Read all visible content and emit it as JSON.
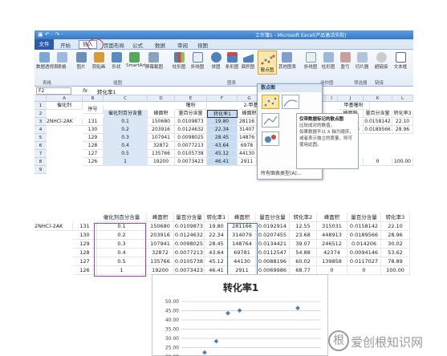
{
  "window": {
    "title": "工作簿1 - Microsoft Excel(产品激活失败)",
    "quick_access": "▣ ↶ · ↷ ·"
  },
  "tabs": [
    "文件",
    "开始",
    "插入",
    "页面布局",
    "公式",
    "数据",
    "审阅",
    "视图"
  ],
  "ribbon": {
    "buttons": [
      "数据透视表",
      "表格",
      "图片",
      "剪贴画",
      "形状",
      "SmartArt",
      "屏幕截图",
      "柱形图",
      "折线图",
      "饼图",
      "条形图",
      "面积图",
      "散点图",
      "其他图表",
      "折线图",
      "柱形图",
      "盈亏",
      "切片器",
      "超链接",
      "文本框"
    ],
    "groups": [
      "表格",
      "插图",
      "图表",
      "迷你图",
      "筛选器",
      "链接"
    ]
  },
  "formula_bar": {
    "name_box": "F2",
    "fx": "fx",
    "value": "转化率1"
  },
  "columns": [
    "A",
    "B",
    "C",
    "D",
    "E",
    "F",
    "G",
    "H",
    "I",
    "J",
    "K",
    "L"
  ],
  "dropdown": {
    "header": "散点图",
    "more": "所有图表类型(A)...",
    "tooltip_title": "仅带数据标记的散点图",
    "tooltip_desc1": "比较成对的数值。",
    "tooltip_desc2": "如果数据不以 X 轴为顺序，或者表示独立的度量，则可使用此图。"
  },
  "top_sheet": {
    "row_numbers": [
      "1",
      "2",
      "3",
      "4",
      "5",
      "6",
      "7",
      "8",
      "9"
    ],
    "catalyst_label": "催化剂",
    "catalyst_value": "2NHCl-2AK",
    "seq_label": "序号",
    "pct_label": "催化剂百分含量",
    "group1_title": "噻吩",
    "group2_title": "2-甲基噻",
    "group3_title": "甲基噻吩",
    "col_area": "峰面积",
    "col_mass": "量百分含量",
    "col_conv1": "转化率1",
    "col_conv3": "转化率3",
    "rows": [
      {
        "seq": "131",
        "pct": "0.1",
        "area": "150680",
        "mass": "0.0109873",
        "conv": "19.80",
        "g": "28116",
        "j": "315031",
        "k": "0.0158142",
        "l": "22.10"
      },
      {
        "seq": "130",
        "pct": "0.2",
        "area": "203916",
        "mass": "0.0124632",
        "conv": "22.34",
        "g": "31407",
        "j": "448913",
        "k": "0.0189566",
        "l": "28.96"
      },
      {
        "seq": "129",
        "pct": "0.3",
        "area": "107941",
        "mass": "0.0098025",
        "conv": "28.45",
        "g": "14876",
        "j": "",
        "k": "",
        "l": ""
      },
      {
        "seq": "128",
        "pct": "0.4",
        "area": "32872",
        "mass": "0.0077213",
        "conv": "43.64",
        "g": "6978",
        "j": "",
        "k": "",
        "l": ""
      },
      {
        "seq": "127",
        "pct": "0.5",
        "area": "135766",
        "mass": "0.0105738",
        "conv": "45.12",
        "g": "44130",
        "j": "",
        "k": "",
        "l": ""
      },
      {
        "seq": "126",
        "pct": "1",
        "area": "19200",
        "mass": "0.0073423",
        "conv": "46.41",
        "g": "2911",
        "j": "0",
        "k": "0",
        "l": "100.00"
      }
    ]
  },
  "bottom_sheet": {
    "catalyst_value": "2NHCl-2AK",
    "headers": [
      "催化剂百分含量",
      "峰面积",
      "量百分含量",
      "转化率1",
      "峰面积",
      "量百分含量",
      "转化率2",
      "峰面积",
      "量百分含量",
      "转化率3"
    ],
    "rows": [
      [
        "131",
        "0.1",
        "150680",
        "0.0109873",
        "19.80",
        "281166",
        "0.0192914",
        "12.55",
        "315031",
        "0.0158142",
        "22.10"
      ],
      [
        "130",
        "0.2",
        "203916",
        "0.0124632",
        "22.34",
        "314079",
        "0.0207455",
        "23.68",
        "448913",
        "0.0189566",
        "28.96"
      ],
      [
        "129",
        "0.3",
        "107941",
        "0.0098025",
        "28.45",
        "148764",
        "0.0134421",
        "39.07",
        "246512",
        "0.014206",
        "30.02"
      ],
      [
        "128",
        "0.4",
        "32872",
        "0.0077213",
        "43.64",
        "69781",
        "0.0112547",
        "54.88",
        "42374",
        "0.0094146",
        "53.62"
      ],
      [
        "127",
        "0.5",
        "135766",
        "0.0105738",
        "45.12",
        "44130",
        "0.0088196",
        "60.02",
        "139858",
        "0.0117027",
        "78.89"
      ],
      [
        "126",
        "1",
        "19200",
        "0.0073423",
        "46.41",
        "2911",
        "0.0069986",
        "68.77",
        "0",
        "0",
        "100.00"
      ]
    ]
  },
  "chart_data": {
    "type": "scatter",
    "title": "转化率1",
    "x": [
      0.1,
      0.2,
      0.3,
      0.4,
      0.5,
      1
    ],
    "y": [
      19.8,
      22.34,
      28.45,
      43.64,
      45.12,
      46.41
    ],
    "y_ticks": [
      "50.00",
      "45.00",
      "40.00",
      "35.00",
      "30.00",
      "25.00",
      "20.00"
    ],
    "ylim": [
      20,
      50
    ],
    "xlim": [
      0,
      1.2
    ],
    "marker_color": "#4a7ebb",
    "grid": true
  },
  "watermark": {
    "logo": "根",
    "text": "爱创根知识网"
  }
}
